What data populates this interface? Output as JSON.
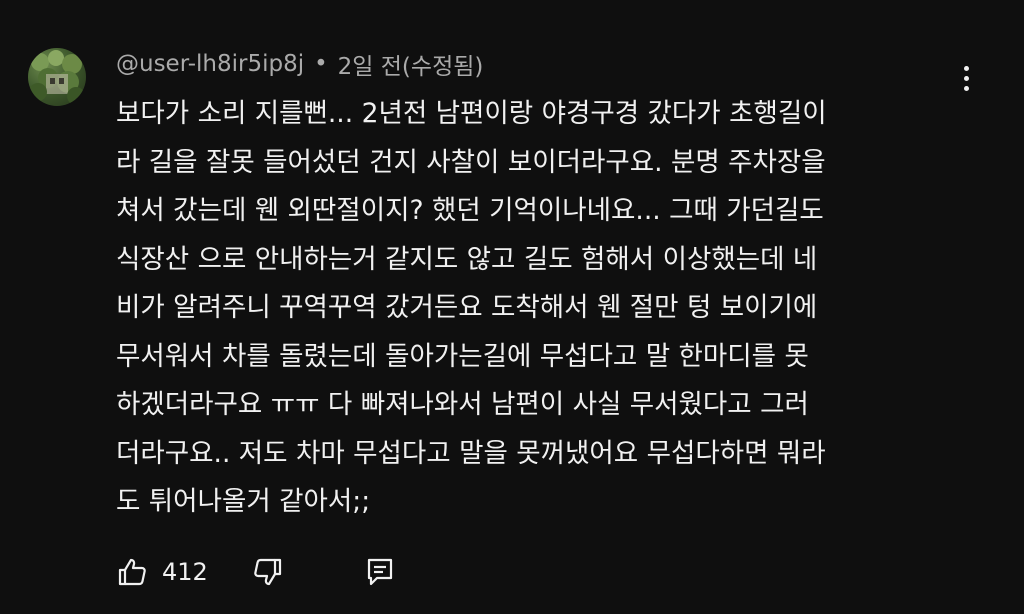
{
  "comment": {
    "author": "@user-lh8ir5ip8j",
    "separator": "•",
    "timestamp": "2일 전(수정됨)",
    "text": "보다가 소리 지를뻔... 2년전 남편이랑 야경구경 갔다가 초행길이\n라 길을 잘못 들어섰던 건지 사찰이 보이더라구요. 분명 주차장을\n쳐서 갔는데 웬 외딴절이지? 했던 기억이나네요... 그때 가던길도\n식장산 으로 안내하는거 같지도 않고 길도 험해서 이상했는데 네\n비가 알려주니 꾸역꾸역 갔거든요 도착해서 웬 절만 텅 보이기에\n무서워서 차를 돌렸는데 돌아가는길에 무섭다고 말 한마디를 못\n하겠더라구요 ㅠㅠ 다 빠져나와서 남편이 사실 무서웠다고 그러\n더라구요.. 저도 차마 무섭다고 말을 못꺼냈어요 무섭다하면 뭐라\n도 튀어나올거 같아서;;",
    "like_count": "412"
  },
  "icons": {
    "avatar": "avatar-image",
    "more": "more-vert-icon",
    "like": "thumbs-up-icon",
    "dislike": "thumbs-down-icon",
    "reply": "reply-comment-icon"
  },
  "colors": {
    "background": "#0f0f0f",
    "text_primary": "#f1f1f1",
    "text_secondary": "#aaaaaa"
  }
}
